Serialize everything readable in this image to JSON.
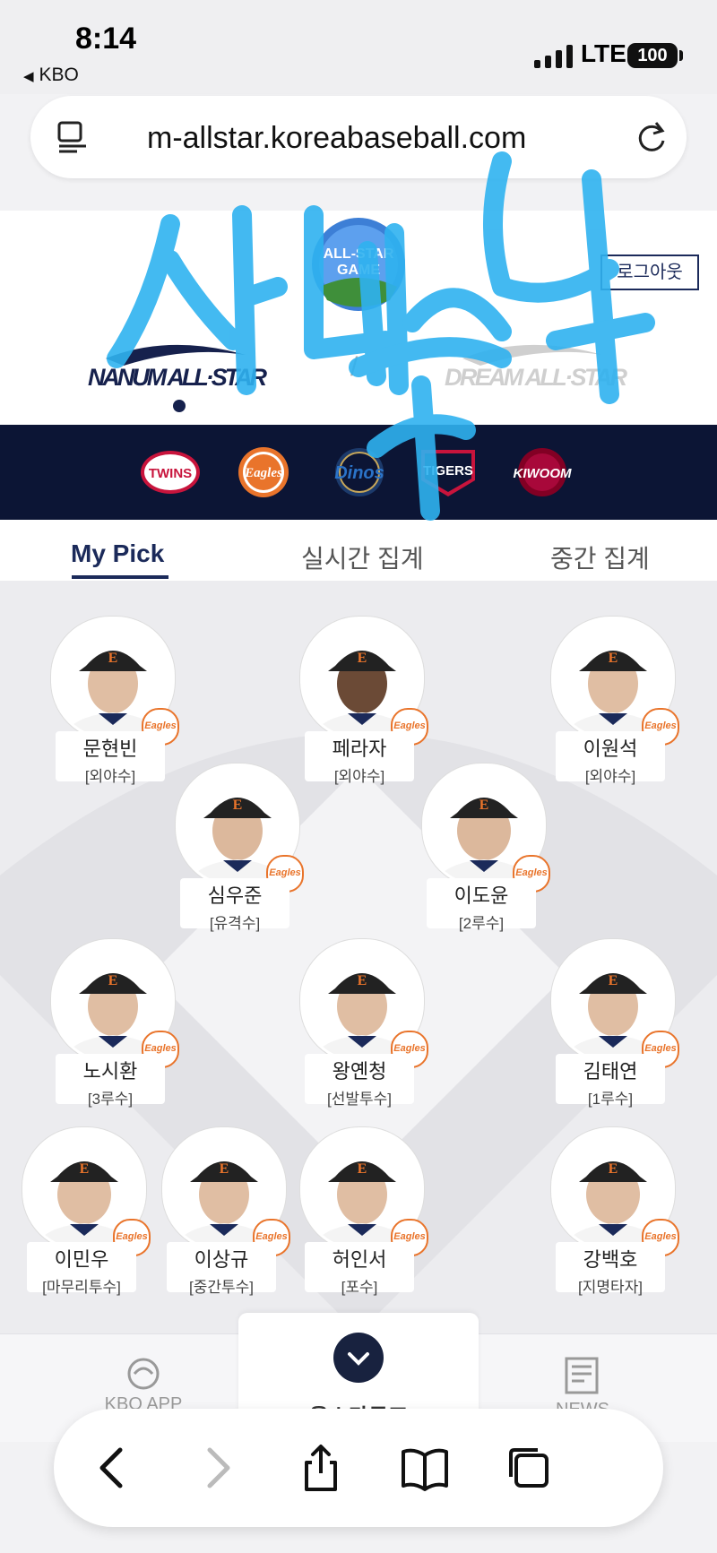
{
  "status": {
    "time": "8:14",
    "back_app": "KBO",
    "network": "LTE",
    "battery": "100"
  },
  "browser": {
    "url": "m-allstar.koreabaseball.com"
  },
  "header": {
    "logout": "로그아웃",
    "emblem_text": "ALL-STAR GAME",
    "nanum": "NANUM ALL-STAR",
    "dream": "DREAM ALL-STAR"
  },
  "teams": [
    "TWINS",
    "Eagles",
    "Dinos",
    "TIGERS",
    "KIWOOM"
  ],
  "tabs": [
    {
      "label": "My Pick",
      "active": true
    },
    {
      "label": "실시간 집계"
    },
    {
      "label": "중간 집계"
    }
  ],
  "badge_text": "Eagles",
  "players": [
    {
      "name": "문현빈",
      "pos": "[외야수]"
    },
    {
      "name": "페라자",
      "pos": "[외야수]"
    },
    {
      "name": "이원석",
      "pos": "[외야수]"
    },
    {
      "name": "심우준",
      "pos": "[유격수]"
    },
    {
      "name": "이도윤",
      "pos": "[2루수]"
    },
    {
      "name": "노시환",
      "pos": "[3루수]"
    },
    {
      "name": "왕옌청",
      "pos": "[선발투수]"
    },
    {
      "name": "김태연",
      "pos": "[1루수]"
    },
    {
      "name": "이민우",
      "pos": "[마무리투수]"
    },
    {
      "name": "이상규",
      "pos": "[중간투수]"
    },
    {
      "name": "허인서",
      "pos": "[포수]"
    },
    {
      "name": "강백호",
      "pos": "[지명타자]"
    }
  ],
  "bottom_nav": {
    "kbo_app": "KBO APP",
    "center": "올스타투표",
    "news": "NEWS"
  },
  "colors": {
    "navy": "#0c1535",
    "eagles_orange": "#e9742b",
    "scribble": "#2fb2f0"
  }
}
